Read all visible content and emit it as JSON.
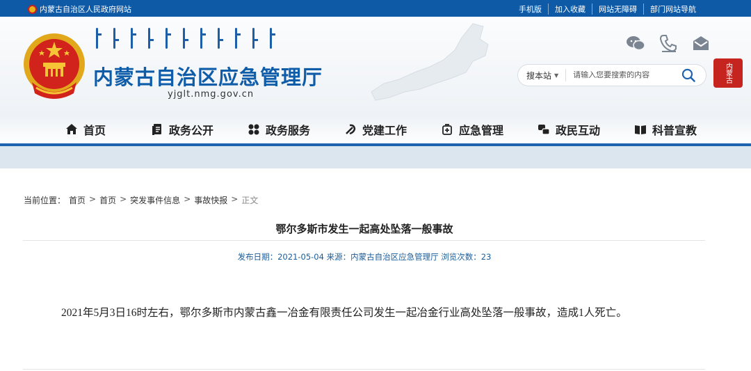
{
  "topbar": {
    "site_label": "内蒙古自治区人民政府网站",
    "links": [
      "手机版",
      "加入收藏",
      "网站无障碍",
      "部门网站导航"
    ]
  },
  "header": {
    "site_name": "内蒙古自治区应急管理厅",
    "domain": "yjglt.nmg.gov.cn",
    "icons": [
      "wechat-icon",
      "phone-icon",
      "mail-icon"
    ],
    "seal_text": "内蒙古"
  },
  "search": {
    "scope": "搜本站",
    "placeholder": "请输入您要搜索的内容"
  },
  "nav": {
    "items": [
      {
        "label": "首页",
        "icon": "home-icon"
      },
      {
        "label": "政务公开",
        "icon": "document-icon"
      },
      {
        "label": "政务服务",
        "icon": "services-icon"
      },
      {
        "label": "党建工作",
        "icon": "party-icon"
      },
      {
        "label": "应急管理",
        "icon": "emergency-icon"
      },
      {
        "label": "政民互动",
        "icon": "interaction-icon"
      },
      {
        "label": "科普宣教",
        "icon": "book-icon"
      }
    ]
  },
  "breadcrumb": {
    "prefix": "当前位置：",
    "items": [
      "首页",
      "首页",
      "突发事件信息",
      "事故快报"
    ],
    "current": "正文",
    "separator": ">"
  },
  "article": {
    "title": "鄂尔多斯市发生一起高处坠落一般事故",
    "meta": "发布日期：2021-05-04 来源：内蒙古自治区应急管理厅 浏览次数：23",
    "body": "2021年5月3日16时左右，鄂尔多斯市内蒙古鑫一冶金有限责任公司发生一起冶金行业高处坠落一般事故，造成1人死亡。"
  },
  "colors": {
    "primary": "#0e5aa7",
    "title_blue": "#0f5ca8",
    "band": "#dbe6ee",
    "seal_red": "#c5241f"
  }
}
